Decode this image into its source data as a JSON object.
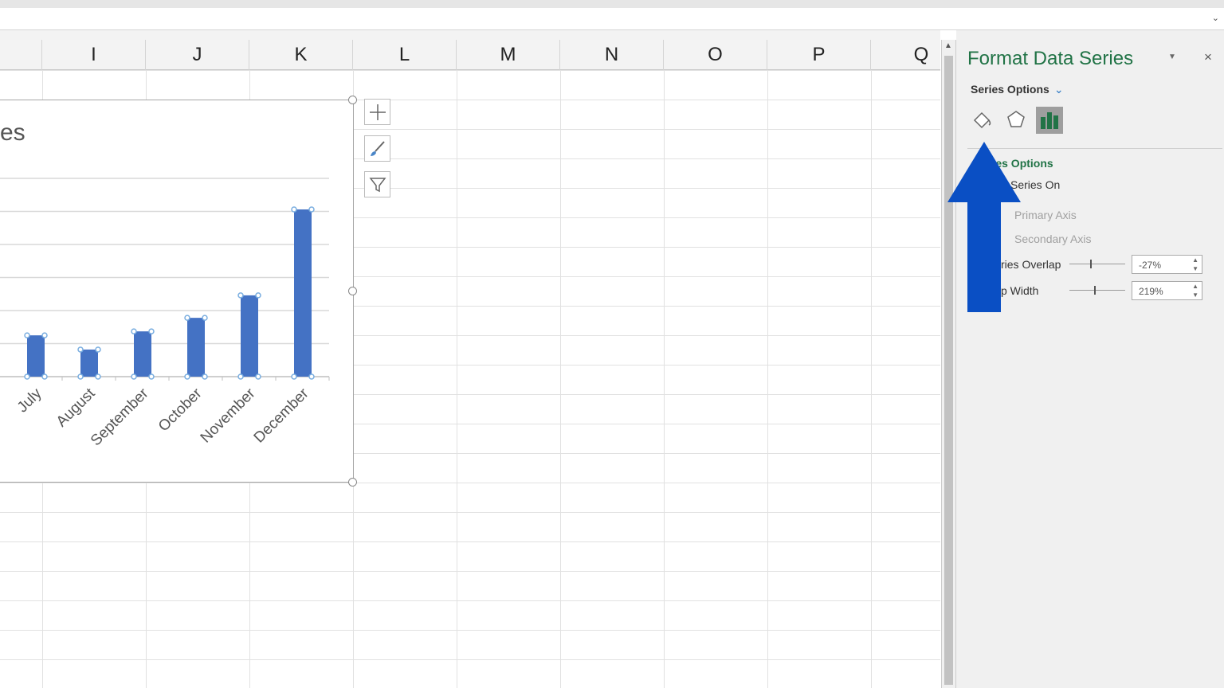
{
  "columns": [
    "I",
    "J",
    "K",
    "L",
    "M",
    "N",
    "O",
    "P",
    "Q"
  ],
  "chart": {
    "title_fragment": "es",
    "type": "bar",
    "bar_color": "#4472c4",
    "categories": [
      "July",
      "August",
      "September",
      "October",
      "November",
      "December"
    ],
    "values": [
      1.25,
      0.82,
      1.37,
      1.78,
      2.46,
      5.06
    ],
    "gridlines": 6,
    "tools": [
      "add-chart-element",
      "chart-styles",
      "chart-filters"
    ]
  },
  "chart_data": {
    "type": "bar",
    "categories": [
      "July",
      "August",
      "September",
      "October",
      "November",
      "December"
    ],
    "values": [
      1.25,
      0.82,
      1.37,
      1.78,
      2.46,
      5.06
    ],
    "title": "es",
    "grid": true,
    "ylim": [
      0,
      6
    ]
  },
  "panel": {
    "title": "Format Data Series",
    "close": "×",
    "dropdown_label": "Series Options",
    "tabs": [
      "fill-line",
      "effects",
      "series-options"
    ],
    "selected_tab": "series-options",
    "section_title": "ries Options",
    "plot_on": "Series On",
    "primary_axis": "Primary Axis",
    "secondary_axis": "Secondary Axis",
    "overlap_label": "ries Overlap",
    "overlap_value": "-27%",
    "gap_label": "p Width",
    "gap_value": "219%",
    "overlap_percent": -27,
    "gap_percent": 219
  },
  "annotation": {
    "arrow_color": "#0a4fc4",
    "direction": "up"
  }
}
